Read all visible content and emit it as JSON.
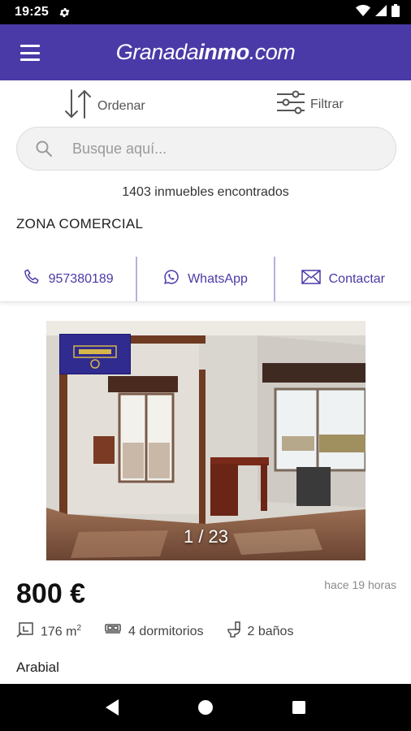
{
  "status_bar": {
    "time": "19:25"
  },
  "header": {
    "logo_regular": "Granada",
    "logo_bold": "inmo",
    "logo_suffix": ".com"
  },
  "toolbar": {
    "sort_label": "Ordenar",
    "filter_label": "Filtrar"
  },
  "search": {
    "placeholder": "Busque aquí..."
  },
  "results": {
    "count_text": "1403 inmuebles encontrados"
  },
  "listing": {
    "agency_zone": "ZONA COMERCIAL",
    "contact": {
      "phone": "957380189",
      "whatsapp": "WhatsApp",
      "contact": "Contactar"
    },
    "photo_counter": "1 / 23",
    "price": "800 €",
    "posted": "hace 19 horas",
    "area": "176 m",
    "area_unit_sup": "2",
    "bedrooms": "4 dormitorios",
    "bathrooms": "2 baños",
    "location": "Arabial"
  },
  "colors": {
    "brand": "#4a3aa7",
    "status_bar": "#000000",
    "nav_bar": "#000000"
  }
}
